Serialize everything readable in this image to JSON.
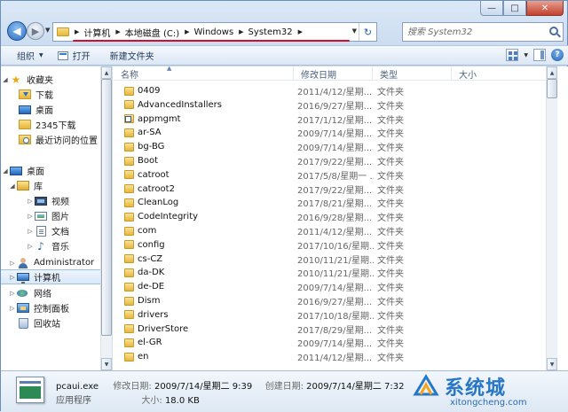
{
  "window": {
    "caption_minimize": "—",
    "caption_maximize": "□",
    "caption_close": "✕"
  },
  "nav": {
    "breadcrumb": [
      "计算机",
      "本地磁盘 (C:)",
      "Windows",
      "System32"
    ],
    "refresh_glyph": "↻",
    "search_placeholder": "搜索 System32"
  },
  "toolbar": {
    "organize_label": "组织",
    "open_label": "打开",
    "new_folder_label": "新建文件夹"
  },
  "sidebar": {
    "favorites_label": "收藏夹",
    "favorites": [
      "下载",
      "桌面",
      "2345下载",
      "最近访问的位置"
    ],
    "desktop_label": "桌面",
    "library_label": "库",
    "libraries": [
      "视频",
      "图片",
      "文档",
      "音乐"
    ],
    "user_label": "Administrator",
    "computer_label": "计算机",
    "network_label": "网络",
    "control_panel_label": "控制面板",
    "recycle_bin_label": "回收站"
  },
  "columns": {
    "name": "名称",
    "date": "修改日期",
    "type": "类型",
    "size": "大小"
  },
  "files": [
    {
      "name": "0409",
      "date": "2011/4/12/星期...",
      "type": "文件夹",
      "shortcut": false
    },
    {
      "name": "AdvancedInstallers",
      "date": "2016/9/27/星期...",
      "type": "文件夹",
      "shortcut": false
    },
    {
      "name": "appmgmt",
      "date": "2017/1/12/星期...",
      "type": "文件夹",
      "shortcut": true
    },
    {
      "name": "ar-SA",
      "date": "2009/7/14/星期...",
      "type": "文件夹",
      "shortcut": false
    },
    {
      "name": "bg-BG",
      "date": "2009/7/14/星期...",
      "type": "文件夹",
      "shortcut": false
    },
    {
      "name": "Boot",
      "date": "2017/9/22/星期...",
      "type": "文件夹",
      "shortcut": false
    },
    {
      "name": "catroot",
      "date": "2017/5/8/星期一 ...",
      "type": "文件夹",
      "shortcut": false
    },
    {
      "name": "catroot2",
      "date": "2017/9/22/星期...",
      "type": "文件夹",
      "shortcut": false
    },
    {
      "name": "CleanLog",
      "date": "2017/8/21/星期...",
      "type": "文件夹",
      "shortcut": false
    },
    {
      "name": "CodeIntegrity",
      "date": "2016/9/28/星期...",
      "type": "文件夹",
      "shortcut": false
    },
    {
      "name": "com",
      "date": "2011/4/12/星期...",
      "type": "文件夹",
      "shortcut": false
    },
    {
      "name": "config",
      "date": "2017/10/16/星期...",
      "type": "文件夹",
      "shortcut": false
    },
    {
      "name": "cs-CZ",
      "date": "2010/11/21/星期...",
      "type": "文件夹",
      "shortcut": false
    },
    {
      "name": "da-DK",
      "date": "2010/11/21/星期...",
      "type": "文件夹",
      "shortcut": false
    },
    {
      "name": "de-DE",
      "date": "2009/7/14/星期...",
      "type": "文件夹",
      "shortcut": false
    },
    {
      "name": "Dism",
      "date": "2016/9/27/星期...",
      "type": "文件夹",
      "shortcut": false
    },
    {
      "name": "drivers",
      "date": "2017/10/18/星期...",
      "type": "文件夹",
      "shortcut": false
    },
    {
      "name": "DriverStore",
      "date": "2017/8/29/星期...",
      "type": "文件夹",
      "shortcut": false
    },
    {
      "name": "el-GR",
      "date": "2009/7/14/星期...",
      "type": "文件夹",
      "shortcut": false
    },
    {
      "name": "en",
      "date": "2011/4/12/星期...",
      "type": "文件夹",
      "shortcut": false
    }
  ],
  "details": {
    "file_name": "pcaui.exe",
    "file_type": "应用程序",
    "modified_label": "修改日期:",
    "modified_value": "2009/7/14/星期二 9:39",
    "created_label": "创建日期:",
    "created_value": "2009/7/14/星期二 7:32",
    "size_label": "大小:",
    "size_value": "18.0 KB"
  },
  "watermark": {
    "title": "系统城",
    "url": "xitongcheng.com"
  },
  "colors": {
    "accent": "#2776c7",
    "address_underline": "#d0102a",
    "folder": "#e6b73a"
  }
}
